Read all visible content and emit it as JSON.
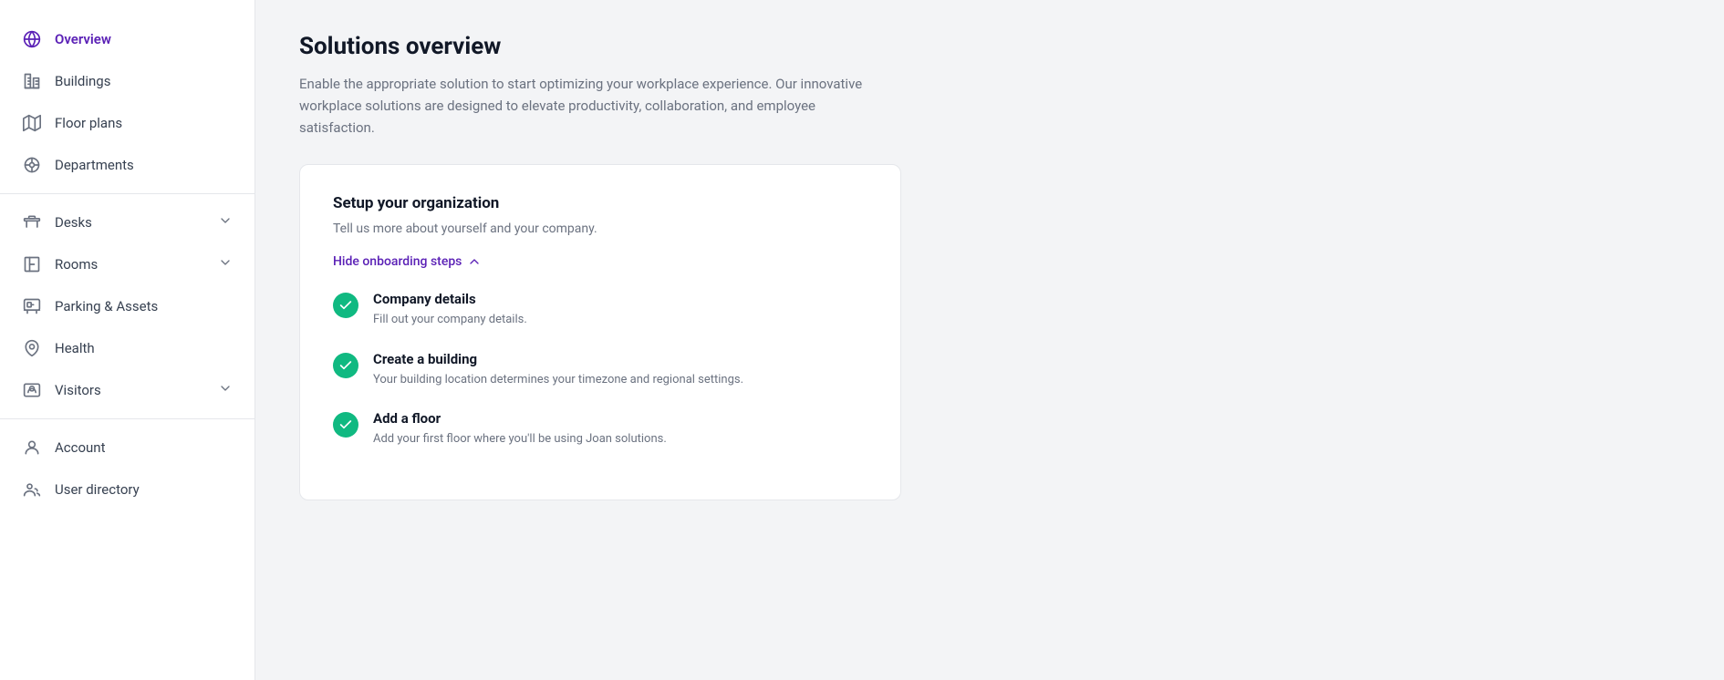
{
  "sidebar": {
    "items": [
      {
        "id": "overview",
        "label": "Overview",
        "icon": "globe",
        "active": true,
        "hasChevron": false
      },
      {
        "id": "buildings",
        "label": "Buildings",
        "icon": "buildings",
        "active": false,
        "hasChevron": false
      },
      {
        "id": "floor-plans",
        "label": "Floor plans",
        "icon": "map",
        "active": false,
        "hasChevron": false
      },
      {
        "id": "departments",
        "label": "Departments",
        "icon": "departments",
        "active": false,
        "hasChevron": false
      },
      {
        "id": "desks",
        "label": "Desks",
        "icon": "desks",
        "active": false,
        "hasChevron": true
      },
      {
        "id": "rooms",
        "label": "Rooms",
        "icon": "rooms",
        "active": false,
        "hasChevron": true
      },
      {
        "id": "parking-assets",
        "label": "Parking & Assets",
        "icon": "parking",
        "active": false,
        "hasChevron": false
      },
      {
        "id": "health",
        "label": "Health",
        "icon": "health",
        "active": false,
        "hasChevron": false
      },
      {
        "id": "visitors",
        "label": "Visitors",
        "icon": "visitors",
        "active": false,
        "hasChevron": true
      },
      {
        "id": "account",
        "label": "Account",
        "icon": "account",
        "active": false,
        "hasChevron": false
      },
      {
        "id": "user-directory",
        "label": "User directory",
        "icon": "user-directory",
        "active": false,
        "hasChevron": false
      }
    ]
  },
  "main": {
    "title": "Solutions overview",
    "description": "Enable the appropriate solution to start optimizing your workplace experience. Our innovative workplace solutions are designed to elevate productivity, collaboration, and employee satisfaction.",
    "setup_card": {
      "title": "Setup your organization",
      "subtitle": "Tell us more about yourself and your company.",
      "hide_link": "Hide onboarding steps",
      "steps": [
        {
          "id": "company-details",
          "name": "Company details",
          "description": "Fill out your company details.",
          "completed": true
        },
        {
          "id": "create-building",
          "name": "Create a building",
          "description": "Your building location determines your timezone and regional settings.",
          "completed": true
        },
        {
          "id": "add-floor",
          "name": "Add a floor",
          "description": "Add your first floor where you'll be using Joan solutions.",
          "completed": true
        }
      ]
    }
  }
}
